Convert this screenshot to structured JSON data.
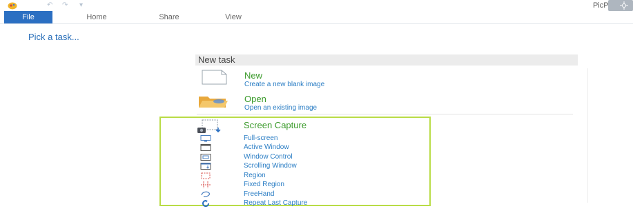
{
  "app": {
    "title": "PicPick"
  },
  "ribbon": {
    "tabs": [
      "File",
      "Home",
      "Share",
      "View"
    ]
  },
  "main": {
    "pick_label": "Pick a task..."
  },
  "panel": {
    "header": "New task",
    "items": [
      {
        "icon": "blank-page-icon",
        "title": "New",
        "desc": "Create a new blank image"
      },
      {
        "icon": "folder-open-icon",
        "title": "Open",
        "desc": "Open an existing image"
      }
    ],
    "capture": {
      "title": "Screen Capture",
      "items": [
        {
          "icon": "monitor-icon",
          "label": "Full-screen"
        },
        {
          "icon": "window-icon",
          "label": "Active Window"
        },
        {
          "icon": "window-control-icon",
          "label": "Window Control"
        },
        {
          "icon": "scrolling-window-icon",
          "label": "Scrolling Window"
        },
        {
          "icon": "region-icon",
          "label": "Region"
        },
        {
          "icon": "fixed-region-icon",
          "label": "Fixed Region"
        },
        {
          "icon": "freehand-icon",
          "label": "FreeHand"
        },
        {
          "icon": "repeat-icon",
          "label": "Repeat Last Capture"
        }
      ]
    }
  },
  "colors": {
    "accent": "#2b6fc2",
    "title_green": "#3a9a2a",
    "link_blue": "#2a7dc4",
    "highlight_border": "#b9dc46"
  }
}
